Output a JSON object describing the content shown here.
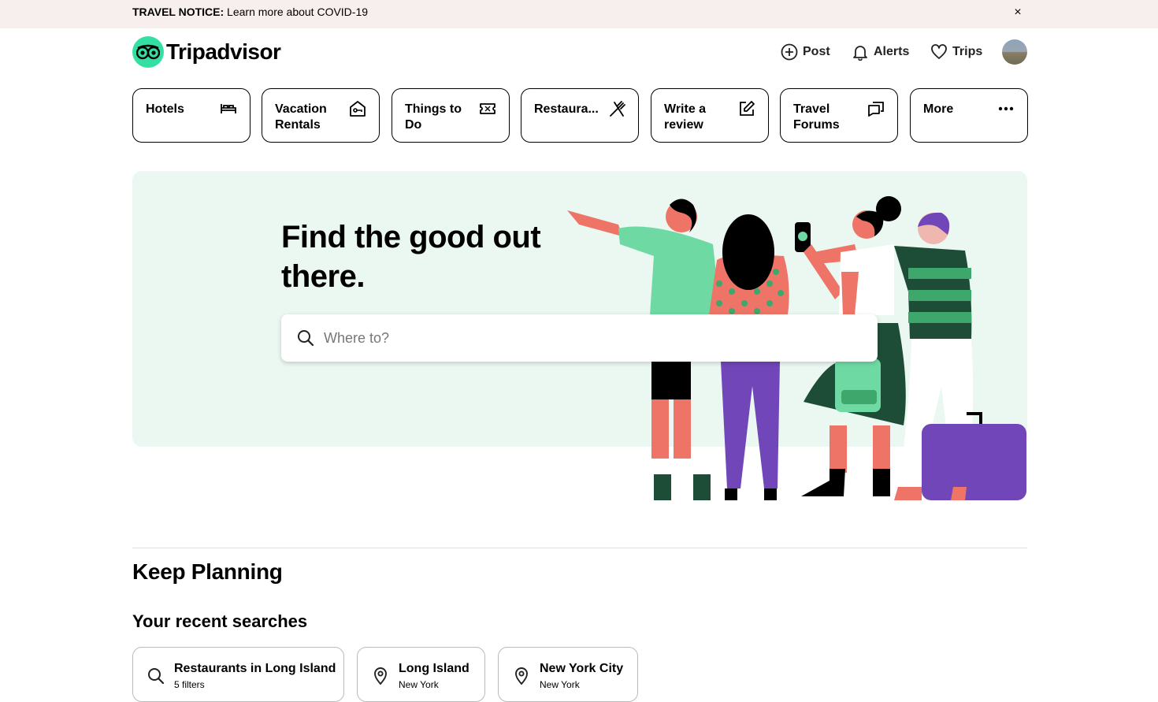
{
  "notice": {
    "label": "TRAVEL NOTICE:",
    "text": "Learn more about COVID-19",
    "close": "×"
  },
  "header": {
    "logo_text": "Tripadvisor",
    "post": "Post",
    "alerts": "Alerts",
    "trips": "Trips"
  },
  "categories": [
    {
      "label": "Hotels",
      "icon": "bed-icon"
    },
    {
      "label": "Vacation Rentals",
      "icon": "house-key-icon"
    },
    {
      "label": "Things to Do",
      "icon": "ticket-icon"
    },
    {
      "label": "Restaura...",
      "icon": "fork-knife-icon"
    },
    {
      "label": "Write a review",
      "icon": "edit-icon"
    },
    {
      "label": "Travel Forums",
      "icon": "chat-icon"
    },
    {
      "label": "More",
      "icon": "more-dots-icon"
    }
  ],
  "hero": {
    "title": "Find the good out there.",
    "search_placeholder": "Where to?"
  },
  "keep_planning": {
    "title": "Keep Planning",
    "recent_title": "Your recent searches",
    "recent": [
      {
        "title": "Restaurants in Long Island",
        "sub": "5 filters",
        "icon": "search-icon"
      },
      {
        "title": "Long Island",
        "sub": "New York",
        "icon": "location-pin-icon"
      },
      {
        "title": "New York City",
        "sub": "New York",
        "icon": "location-pin-icon"
      }
    ]
  },
  "colors": {
    "brand": "#34e0a1",
    "hero_bg": "#ebf7f1",
    "notice_bg": "#f7efed"
  }
}
